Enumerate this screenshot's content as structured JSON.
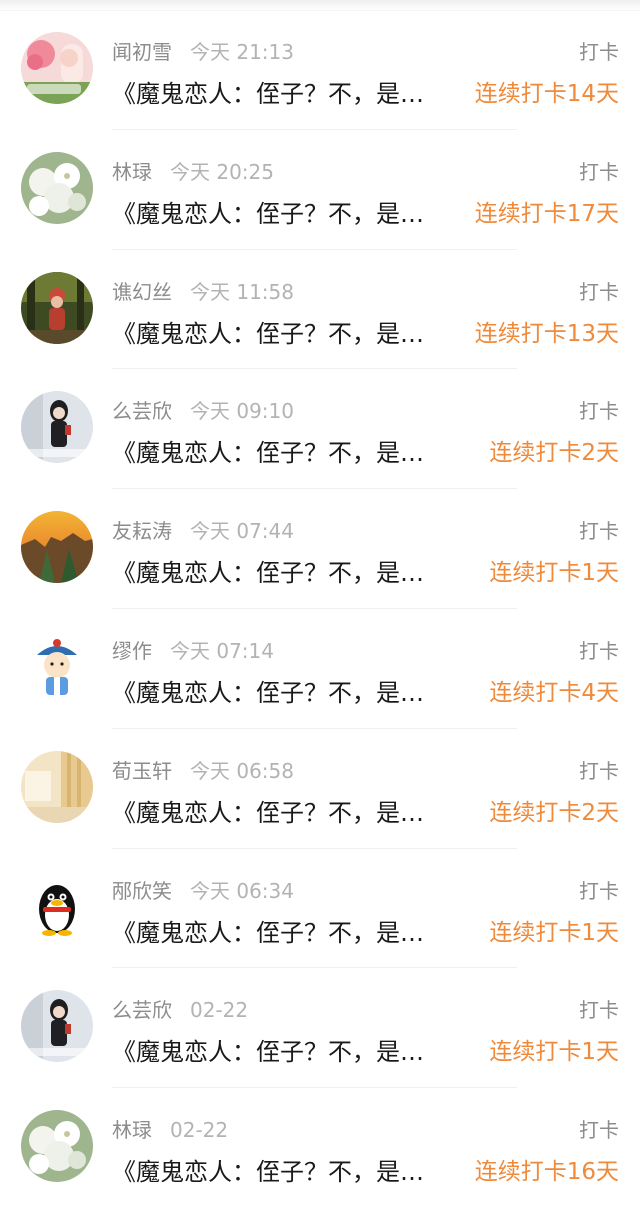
{
  "feed": [
    {
      "name": "闻初雪",
      "time": "今天 21:13",
      "action": "打卡",
      "message": "《魔鬼恋人：侄子？不，是…",
      "streak": "连续打卡14天",
      "avatar": "photo-flower-girl-avatar"
    },
    {
      "name": "林琭",
      "time": "今天 20:25",
      "action": "打卡",
      "message": "《魔鬼恋人：侄子？不，是…",
      "streak": "连续打卡17天",
      "avatar": "white-flowers-avatar"
    },
    {
      "name": "谯幻丝",
      "time": "今天 11:58",
      "action": "打卡",
      "message": "《魔鬼恋人：侄子？不，是…",
      "streak": "连续打卡13天",
      "avatar": "girl-in-forest-avatar"
    },
    {
      "name": "么芸欣",
      "time": "今天 09:10",
      "action": "打卡",
      "message": "《魔鬼恋人：侄子？不，是…",
      "streak": "连续打卡2天",
      "avatar": "girl-standing-avatar"
    },
    {
      "name": "友耘涛",
      "time": "今天 07:44",
      "action": "打卡",
      "message": "《魔鬼恋人：侄子？不，是…",
      "streak": "连续打卡1天",
      "avatar": "sunset-cliff-avatar"
    },
    {
      "name": "缪作",
      "time": "今天 07:14",
      "action": "打卡",
      "message": "《魔鬼恋人：侄子？不，是…",
      "streak": "连续打卡4天",
      "avatar": "cartoon-qing-official-avatar"
    },
    {
      "name": "荀玉轩",
      "time": "今天 06:58",
      "action": "打卡",
      "message": "《魔鬼恋人：侄子？不，是…",
      "streak": "连续打卡2天",
      "avatar": "curtain-room-avatar"
    },
    {
      "name": "邴欣笑",
      "time": "今天 06:34",
      "action": "打卡",
      "message": "《魔鬼恋人：侄子？不，是…",
      "streak": "连续打卡1天",
      "avatar": "penguin-avatar"
    },
    {
      "name": "么芸欣",
      "time": "02-22",
      "action": "打卡",
      "message": "《魔鬼恋人：侄子？不，是…",
      "streak": "连续打卡1天",
      "avatar": "girl-standing-avatar"
    },
    {
      "name": "林琭",
      "time": "02-22",
      "action": "打卡",
      "message": "《魔鬼恋人：侄子？不，是…",
      "streak": "连续打卡16天",
      "avatar": "white-flowers-avatar"
    }
  ],
  "colors": {
    "streak": "#ef8a3b",
    "meta": "#8c8c8c",
    "time": "#b3b3b3",
    "text": "#1a1a1a"
  }
}
